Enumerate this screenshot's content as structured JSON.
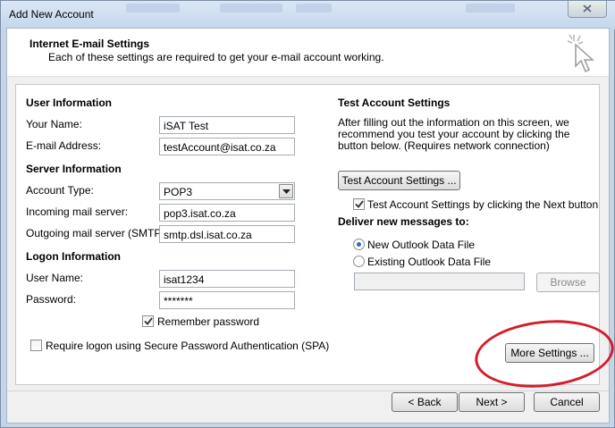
{
  "window": {
    "title": "Add New Account"
  },
  "header": {
    "title": "Internet E-mail Settings",
    "subtitle": "Each of these settings are required to get your e-mail account working."
  },
  "user_info": {
    "heading": "User Information",
    "name_label": "Your Name:",
    "name_value": "iSAT Test",
    "email_label": "E-mail Address:",
    "email_value": "testAccount@isat.co.za"
  },
  "server_info": {
    "heading": "Server Information",
    "account_type_label": "Account Type:",
    "account_type_value": "POP3",
    "incoming_label": "Incoming mail server:",
    "incoming_value": "pop3.isat.co.za",
    "outgoing_label": "Outgoing mail server (SMTP):",
    "outgoing_value": "smtp.dsl.isat.co.za"
  },
  "logon_info": {
    "heading": "Logon Information",
    "username_label": "User Name:",
    "username_value": "isat1234",
    "password_label": "Password:",
    "password_value": "*******",
    "remember_label": "Remember password",
    "remember_checked": true,
    "spa_label": "Require logon using Secure Password Authentication (SPA)",
    "spa_checked": false
  },
  "test_settings": {
    "heading": "Test Account Settings",
    "description": "After filling out the information on this screen, we recommend you test your account by clicking the button below. (Requires network connection)",
    "button_label": "Test Account Settings ...",
    "auto_test_label": "Test Account Settings by clicking the Next button",
    "auto_test_checked": true
  },
  "deliver": {
    "heading": "Deliver new messages to:",
    "option_new": "New Outlook Data File",
    "option_existing": "Existing Outlook Data File",
    "selected": "new",
    "browse_label": "Browse"
  },
  "more_settings_label": "More Settings ...",
  "footer": {
    "back_label": "< Back",
    "next_label": "Next >",
    "cancel_label": "Cancel"
  },
  "colors": {
    "highlight_oval": "#d21e2a",
    "radio_accent": "#2a6ad0"
  },
  "icons": {
    "close": "close-x-icon",
    "wizard": "cursor-sparkle-icon",
    "dropdown": "chevron-down-icon",
    "check": "checkmark-icon"
  }
}
